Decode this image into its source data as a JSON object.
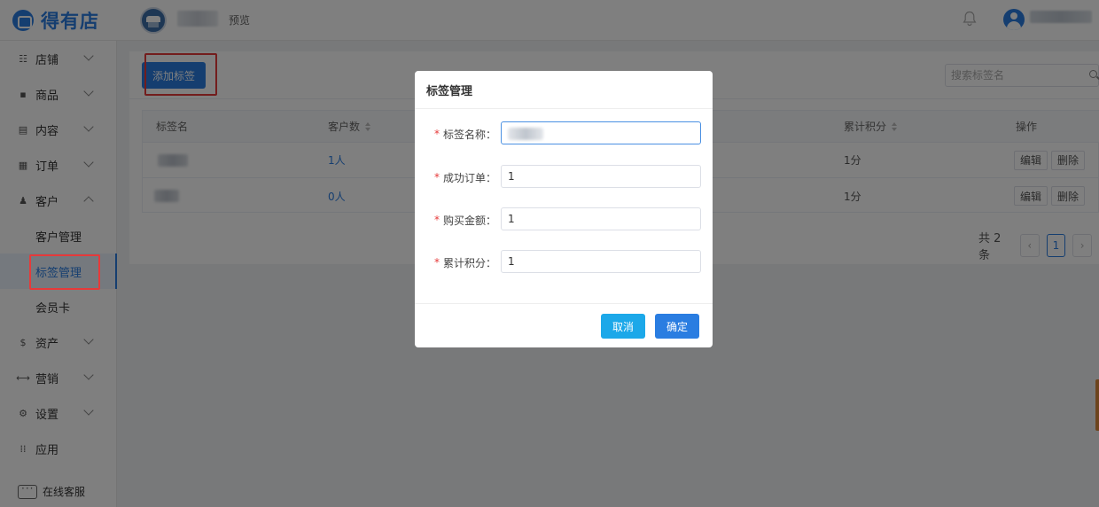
{
  "brand": {
    "name": "得有店"
  },
  "header": {
    "preview_label": "预览"
  },
  "sidebar": {
    "items": [
      {
        "label": "店铺",
        "icon": "shop-icon"
      },
      {
        "label": "商品",
        "icon": "goods-icon"
      },
      {
        "label": "内容",
        "icon": "content-icon"
      },
      {
        "label": "订单",
        "icon": "order-icon"
      },
      {
        "label": "客户",
        "icon": "customer-icon",
        "expanded": true,
        "children": [
          {
            "label": "客户管理"
          },
          {
            "label": "标签管理",
            "active": true
          },
          {
            "label": "会员卡"
          }
        ]
      },
      {
        "label": "资产",
        "icon": "asset-icon"
      },
      {
        "label": "营销",
        "icon": "marketing-icon"
      },
      {
        "label": "设置",
        "icon": "settings-icon"
      },
      {
        "label": "应用",
        "icon": "apps-icon"
      }
    ],
    "chat_label": "在线客服"
  },
  "toolbar": {
    "add_label": "添加标签",
    "search_placeholder": "搜索标签名"
  },
  "table": {
    "columns": [
      "标签名",
      "客户数",
      "累计积分",
      "操作"
    ],
    "rows": [
      {
        "customers": "1人",
        "points": "1分"
      },
      {
        "customers": "0人",
        "points": "1分"
      }
    ],
    "edit_label": "编辑",
    "delete_label": "删除"
  },
  "pagination": {
    "total": "共 2 条",
    "current_page": "1"
  },
  "modal": {
    "title": "标签管理",
    "fields": [
      {
        "label": "标签名称：",
        "value": ""
      },
      {
        "label": "成功订单：",
        "value": "1"
      },
      {
        "label": "购买金额：",
        "value": "1"
      },
      {
        "label": "累计积分：",
        "value": "1"
      }
    ],
    "required_mark": "*",
    "cancel_label": "取消",
    "confirm_label": "确定"
  },
  "colors": {
    "primary": "#2a7de1",
    "cancel": "#1ca8e9",
    "highlight": "#e63a3a"
  }
}
